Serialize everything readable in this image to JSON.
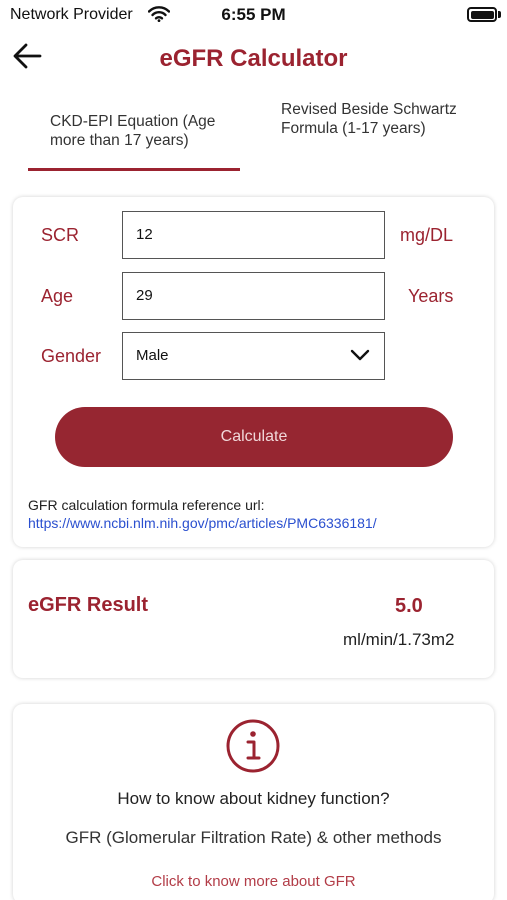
{
  "status_bar": {
    "carrier": "Network Provider",
    "time": "6:55 PM"
  },
  "header": {
    "title": "eGFR Calculator"
  },
  "tabs": [
    {
      "label": "CKD-EPI Equation (Age more than 17 years)",
      "selected": true
    },
    {
      "label": "Revised Beside Schwartz Formula (1-17 years)",
      "selected": false
    }
  ],
  "form": {
    "scr": {
      "label": "SCR",
      "value": "12",
      "unit": "mg/DL"
    },
    "age": {
      "label": "Age",
      "value": "29",
      "unit": "Years"
    },
    "gender": {
      "label": "Gender",
      "value": "Male"
    },
    "calculate_label": "Calculate",
    "reference_label": "GFR calculation formula reference url:",
    "reference_url": "https://www.ncbi.nlm.nih.gov/pmc/articles/PMC6336181/"
  },
  "result": {
    "label": "eGFR Result",
    "value": "5.0",
    "unit": "ml/min/1.73m2"
  },
  "info": {
    "icon": "info-icon",
    "question": "How to know about kidney function?",
    "subtitle": "GFR (Glomerular Filtration Rate) & other methods",
    "link": "Click to know more about GFR"
  },
  "colors": {
    "accent": "#9b2330",
    "button": "#962631",
    "link": "#2a4fcf"
  }
}
